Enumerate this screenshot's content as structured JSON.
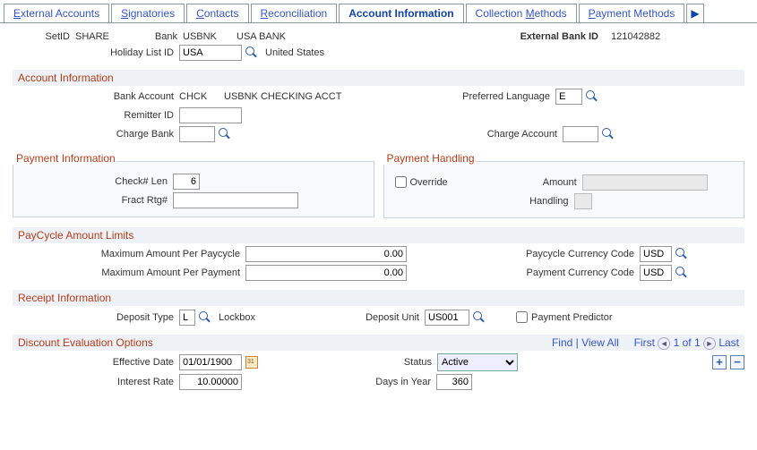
{
  "tabs": {
    "external_accounts": "External Accounts",
    "signatories": "Signatories",
    "contacts": "Contacts",
    "reconciliation": "Reconciliation",
    "account_information": "Account Information",
    "collection_methods": "Collection Methods",
    "payment_methods": "Payment Methods"
  },
  "header": {
    "setid_label": "SetID",
    "setid_value": "SHARE",
    "bank_label": "Bank",
    "bank_code": "USBNK",
    "bank_name": "USA BANK",
    "external_bank_id_label": "External Bank ID",
    "external_bank_id_value": "121042882",
    "holiday_list_id_label": "Holiday List ID",
    "holiday_list_id_value": "USA",
    "holiday_list_id_desc": "United States"
  },
  "account_info": {
    "title": "Account Information",
    "bank_account_label": "Bank Account",
    "bank_account_code": "CHCK",
    "bank_account_name": "USBNK CHECKING ACCT",
    "preferred_language_label": "Preferred Language",
    "preferred_language_value": "E",
    "remitter_id_label": "Remitter ID",
    "remitter_id_value": "",
    "charge_bank_label": "Charge Bank",
    "charge_bank_value": "",
    "charge_account_label": "Charge Account",
    "charge_account_value": ""
  },
  "payment_info": {
    "title": "Payment Information",
    "check_len_label": "Check# Len",
    "check_len_value": "6",
    "fract_rtg_label": "Fract Rtg#",
    "fract_rtg_value": ""
  },
  "payment_handling": {
    "title": "Payment Handling",
    "override_label": "Override",
    "override_checked": false,
    "amount_label": "Amount",
    "amount_value": "",
    "handling_label": "Handling",
    "handling_value": ""
  },
  "paycycle": {
    "title": "PayCycle Amount Limits",
    "max_per_paycycle_label": "Maximum Amount Per Paycycle",
    "max_per_paycycle_value": "0.00",
    "paycycle_currency_label": "Paycycle Currency Code",
    "paycycle_currency_value": "USD",
    "max_per_payment_label": "Maximum Amount Per Payment",
    "max_per_payment_value": "0.00",
    "payment_currency_label": "Payment Currency Code",
    "payment_currency_value": "USD"
  },
  "receipt": {
    "title": "Receipt Information",
    "deposit_type_label": "Deposit Type",
    "deposit_type_value": "L",
    "deposit_type_desc": "Lockbox",
    "deposit_unit_label": "Deposit Unit",
    "deposit_unit_value": "US001",
    "payment_predictor_label": "Payment Predictor",
    "payment_predictor_checked": false
  },
  "discount": {
    "title": "Discount Evaluation Options",
    "find_label": "Find",
    "viewall_label": "View All",
    "first_label": "First",
    "nav_text": "1 of 1",
    "last_label": "Last",
    "effective_date_label": "Effective Date",
    "effective_date_value": "01/01/1900",
    "status_label": "Status",
    "status_value": "Active",
    "interest_rate_label": "Interest Rate",
    "interest_rate_value": "10.00000",
    "days_in_year_label": "Days in Year",
    "days_in_year_value": "360"
  }
}
